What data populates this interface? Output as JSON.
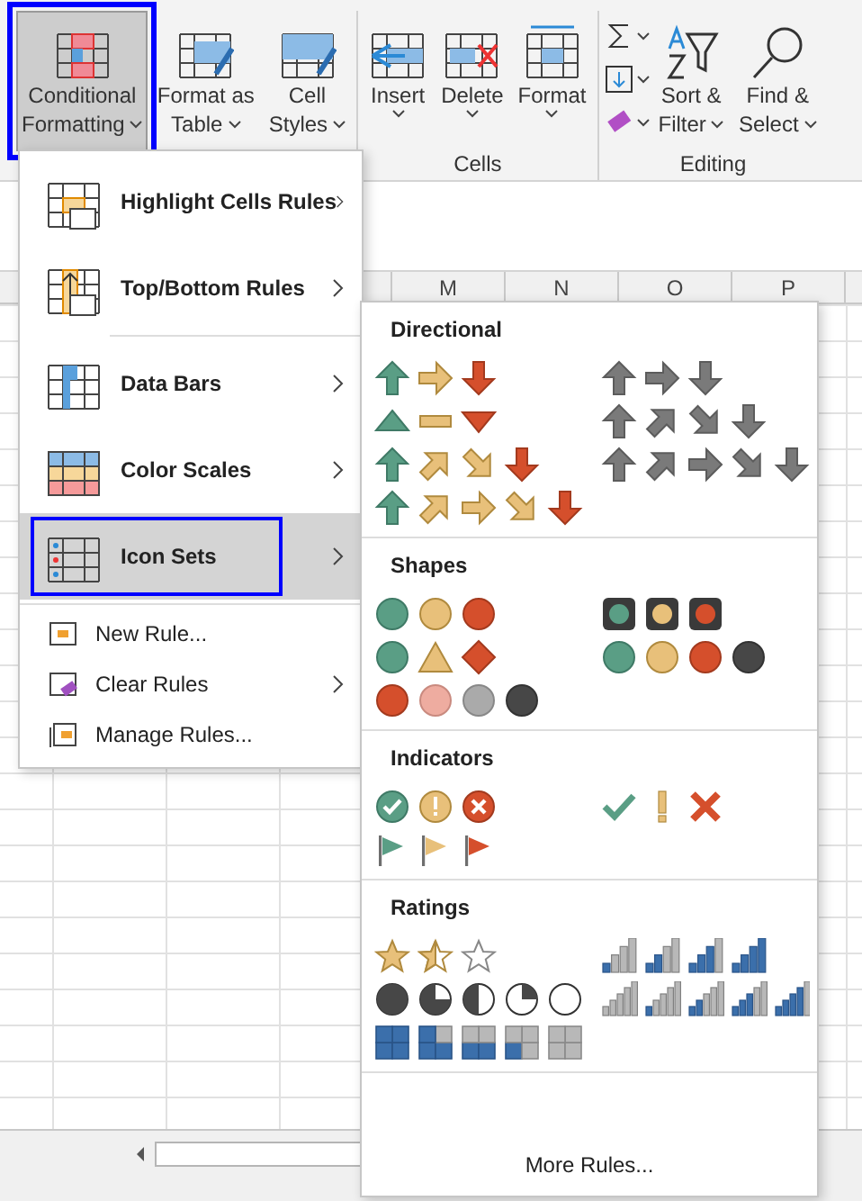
{
  "ribbon": {
    "buttons": [
      {
        "lines": [
          "Conditional",
          "Formatting"
        ],
        "kind": "cf",
        "selected": true,
        "highlighted": true,
        "caret": true
      },
      {
        "lines": [
          "Format as",
          "Table"
        ],
        "kind": "table",
        "selected": false,
        "highlighted": false,
        "caret": true
      },
      {
        "lines": [
          "Cell",
          "Styles"
        ],
        "kind": "styles",
        "selected": false,
        "highlighted": false,
        "caret": true
      },
      {
        "lines": [
          "Insert"
        ],
        "kind": "insert",
        "selected": false,
        "highlighted": false,
        "caret": true
      },
      {
        "lines": [
          "Delete"
        ],
        "kind": "delete",
        "selected": false,
        "highlighted": false,
        "caret": true
      },
      {
        "lines": [
          "Format"
        ],
        "kind": "format",
        "selected": false,
        "highlighted": false,
        "caret": true
      },
      {
        "lines": [
          "Sort &",
          "Filter"
        ],
        "kind": "sort",
        "selected": false,
        "highlighted": false,
        "caret": true
      },
      {
        "lines": [
          "Find &",
          "Select"
        ],
        "kind": "find",
        "selected": false,
        "highlighted": false,
        "caret": true
      }
    ],
    "group_labels": [
      "Cells",
      "Editing"
    ]
  },
  "sheet": {
    "columns": [
      "M",
      "N",
      "O",
      "P"
    ]
  },
  "menu": {
    "items": [
      {
        "label": "Highlight Cells Rules",
        "kind": "big",
        "submenu": true,
        "selected": false,
        "highlighted": false
      },
      {
        "label": "Top/Bottom Rules",
        "kind": "big",
        "submenu": true,
        "selected": false,
        "highlighted": false
      },
      {
        "label": "Data Bars",
        "kind": "big",
        "submenu": true,
        "selected": false,
        "highlighted": false
      },
      {
        "label": "Color Scales",
        "kind": "big",
        "submenu": true,
        "selected": false,
        "highlighted": false
      },
      {
        "label": "Icon Sets",
        "kind": "big",
        "submenu": true,
        "selected": true,
        "highlighted": true
      },
      {
        "label": "New Rule...",
        "kind": "small",
        "submenu": false,
        "selected": false,
        "highlighted": false
      },
      {
        "label": "Clear Rules",
        "kind": "small",
        "submenu": true,
        "selected": false,
        "highlighted": false
      },
      {
        "label": "Manage Rules...",
        "kind": "small",
        "submenu": false,
        "selected": false,
        "highlighted": false
      }
    ]
  },
  "icon_sets": {
    "sections": [
      {
        "title": "Directional"
      },
      {
        "title": "Shapes"
      },
      {
        "title": "Indicators"
      },
      {
        "title": "Ratings"
      }
    ],
    "more_rules": "More Rules..."
  }
}
